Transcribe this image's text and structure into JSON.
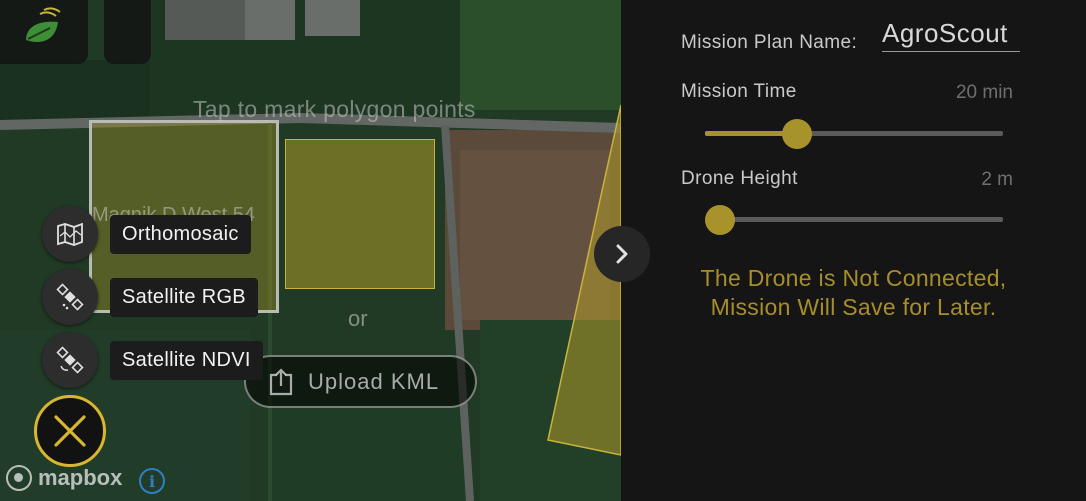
{
  "map": {
    "hint": "Tap to mark polygon points",
    "field_name": "Magnik D West 54",
    "or_text": "or",
    "upload_kml_label": "Upload KML",
    "layers": [
      {
        "label": "Orthomosaic",
        "icon": "map-icon"
      },
      {
        "label": "Satellite RGB",
        "icon": "satellite-icon"
      },
      {
        "label": "Satellite NDVI",
        "icon": "satellite-icon"
      }
    ],
    "attribution": "mapbox",
    "colors": {
      "polygon_fill": "#b19b28",
      "accent": "#d8b72e"
    }
  },
  "panel": {
    "mission_plan_label": "Mission Plan Name:",
    "mission_plan_value": "AgroScout",
    "mission_time_label": "Mission Time",
    "mission_time_value": "20 min",
    "mission_time_fraction": 0.31,
    "drone_height_label": "Drone Height",
    "drone_height_value": "2 m",
    "drone_height_fraction": 0.03,
    "warning": "The Drone is Not Connected, Mission Will Save for Later.",
    "colors": {
      "accent": "#a8922c",
      "background": "#151515"
    }
  }
}
